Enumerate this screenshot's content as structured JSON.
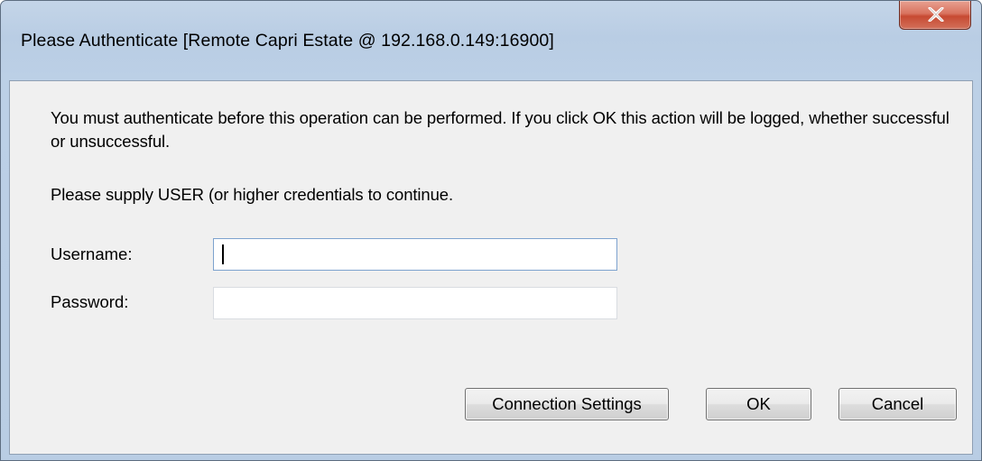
{
  "window": {
    "title": "Please Authenticate [Remote Capri Estate @ 192.168.0.149:16900]"
  },
  "message": {
    "line1": "You must authenticate before this operation can be performed. If you click OK this action will be logged, whether successful or unsuccessful.",
    "line2": "Please supply USER (or higher credentials to continue."
  },
  "form": {
    "username_label": "Username:",
    "username_value": "",
    "password_label": "Password:",
    "password_value": ""
  },
  "buttons": {
    "connection_settings": "Connection Settings",
    "ok": "OK",
    "cancel": "Cancel"
  },
  "icons": {
    "close": "close-icon"
  },
  "colors": {
    "close_button": "#c74a32",
    "window_frame": "#b9cde4",
    "client_background": "#f0f0f0"
  }
}
